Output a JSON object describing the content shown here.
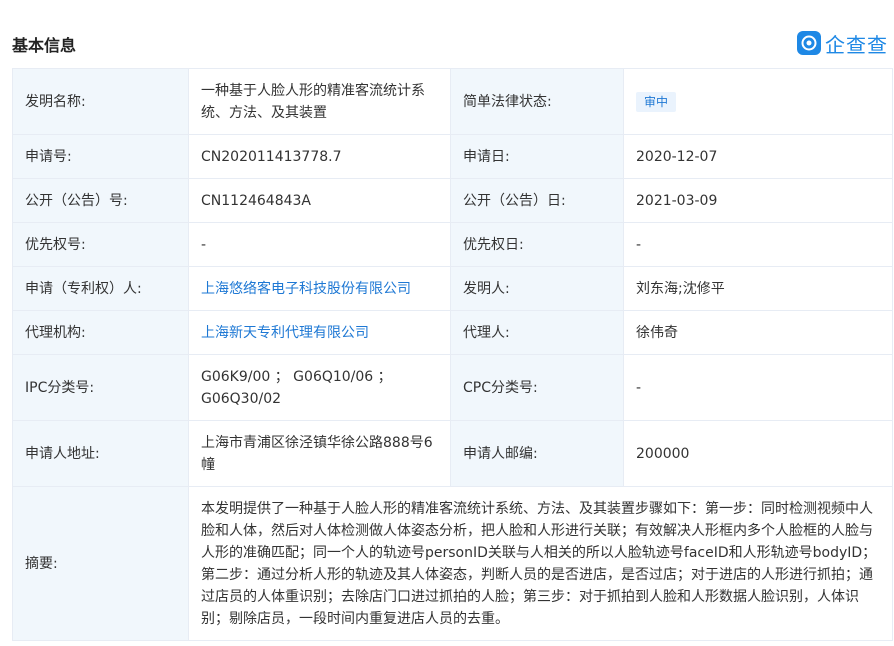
{
  "header": {
    "title": "基本信息",
    "logo_text": "企查查"
  },
  "rows": [
    {
      "label1": "发明名称:",
      "value1": "一种基于人脸人形的精准客流统计系统、方法、及其装置",
      "label2": "简单法律状态:",
      "value2": "审中"
    },
    {
      "label1": "申请号:",
      "value1": "CN202011413778.7",
      "label2": "申请日:",
      "value2": "2020-12-07"
    },
    {
      "label1": "公开（公告）号:",
      "value1": "CN112464843A",
      "label2": "公开（公告）日:",
      "value2": "2021-03-09"
    },
    {
      "label1": "优先权号:",
      "value1": "-",
      "label2": "优先权日:",
      "value2": "-"
    },
    {
      "label1": "申请（专利权）人:",
      "value1": "上海悠络客电子科技股份有限公司",
      "label2": "发明人:",
      "value2": "刘东海;沈修平"
    },
    {
      "label1": "代理机构:",
      "value1": "上海新天专利代理有限公司",
      "label2": "代理人:",
      "value2": "徐伟奇"
    },
    {
      "label1": "IPC分类号:",
      "value1": "G06K9/00 ； G06Q10/06 ； G06Q30/02",
      "label2": "CPC分类号:",
      "value2": "-"
    },
    {
      "label1": "申请人地址:",
      "value1": "上海市青浦区徐泾镇华徐公路888号6幢",
      "label2": "申请人邮编:",
      "value2": "200000"
    }
  ],
  "abstract": {
    "label": "摘要:",
    "text": "本发明提供了一种基于人脸人形的精准客流统计系统、方法、及其装置步骤如下：第一步：同时检测视频中人脸和人体，然后对人体检测做人体姿态分析，把人脸和人形进行关联；有效解决人形框内多个人脸框的人脸与人形的准确匹配；同一个人的轨迹号personID关联与人相关的所以人脸轨迹号faceID和人形轨迹号bodyID；第二步：通过分析人形的轨迹及其人体姿态，判断人员的是否进店，是否过店；对于进店的人形进行抓拍；通过店员的人体重识别；去除店门口进过抓拍的人脸；第三步：对于抓拍到人脸和人形数据人脸识别，人体识别；剔除店员，一段时间内重复进店人员的去重。"
  }
}
